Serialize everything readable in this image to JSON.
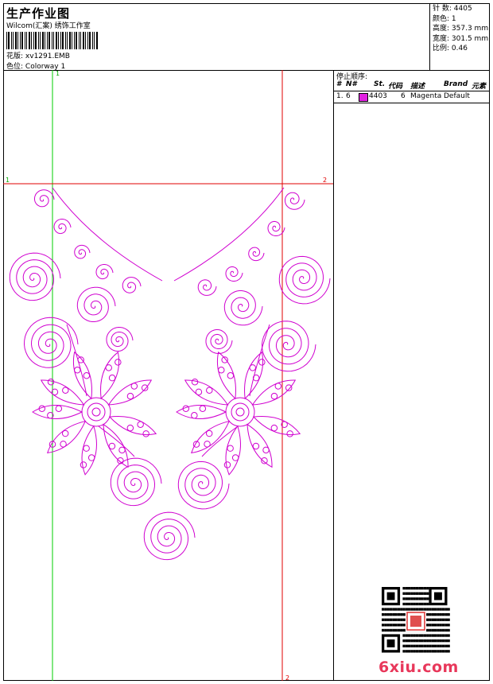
{
  "header": {
    "title": "生产作业图",
    "company": "Wilcom(汇案) 绣饰工作室",
    "design_label": "花版:",
    "design_value": "xv1291.EMB",
    "colorway_label": "色位:",
    "colorway_value": "Colorway 1"
  },
  "stats": [
    {
      "label": "针 数:",
      "value": "4405"
    },
    {
      "label": "颜色:",
      "value": "1"
    },
    {
      "label": "高度:",
      "value": "357.3 mm"
    },
    {
      "label": "宽度:",
      "value": "301.5 mm"
    },
    {
      "label": "比例:",
      "value": "0.46"
    }
  ],
  "stop_sequence": {
    "title": "停止顺序:",
    "columns": [
      "#",
      "N#",
      "St.",
      "代码",
      "描述",
      "Brand",
      "元素"
    ],
    "rows": [
      {
        "num": "1.",
        "needle": "6",
        "color": "#e020e0",
        "stitches": "4403",
        "code": "6",
        "desc": "Magenta",
        "brand": "Default"
      }
    ]
  },
  "guides": {
    "h_left": "1",
    "h_right": "2",
    "v_top": "1",
    "v_bottom": "2"
  },
  "colors": {
    "thread": "#d000d0",
    "guide_green": "#00cc00",
    "guide_red": "#e00000",
    "watermark": "#e8375a"
  },
  "watermark": "6xiu.com"
}
